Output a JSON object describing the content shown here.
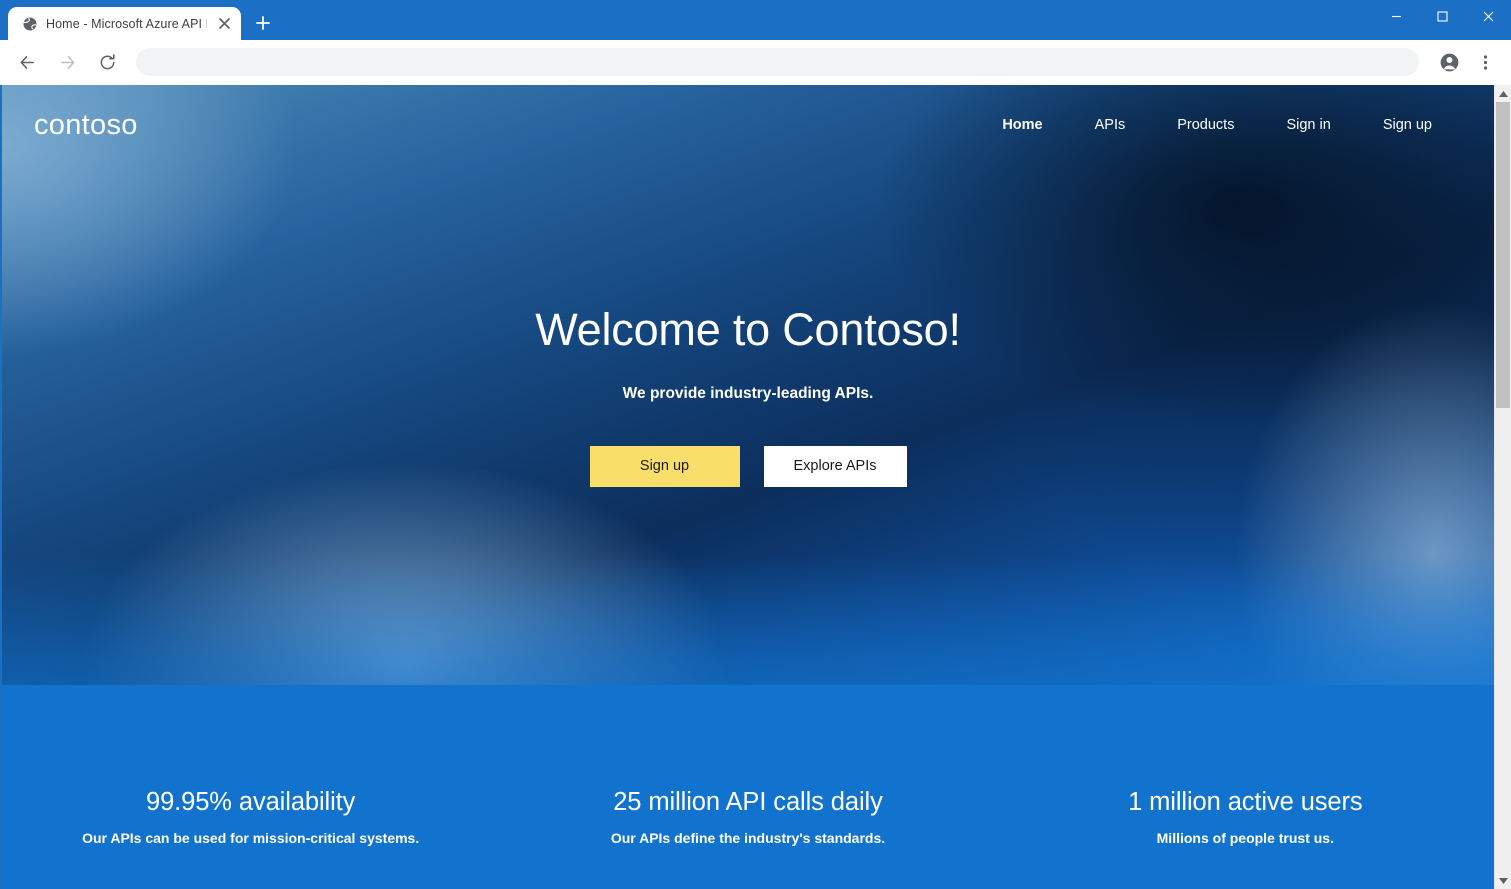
{
  "browser": {
    "tab": {
      "title": "Home - Microsoft Azure API Man",
      "favicon_icon": "globe-icon",
      "close_icon": "close-icon"
    },
    "new_tab_icon": "plus-icon",
    "window_controls": {
      "minimize_icon": "minimize-icon",
      "maximize_icon": "maximize-icon",
      "close_icon": "close-icon"
    },
    "toolbar": {
      "back_icon": "back-arrow-icon",
      "forward_icon": "forward-arrow-icon",
      "reload_icon": "reload-icon",
      "address_value": "",
      "address_placeholder": "",
      "profile_icon": "account-circle-icon",
      "menu_icon": "three-dot-menu-icon"
    },
    "scrollbar": {
      "up_icon": "scroll-up-arrow-icon",
      "down_icon": "scroll-down-arrow-icon"
    }
  },
  "site": {
    "brand": "contoso",
    "nav": [
      {
        "label": "Home",
        "active": true
      },
      {
        "label": "APIs",
        "active": false
      },
      {
        "label": "Products",
        "active": false
      },
      {
        "label": "Sign in",
        "active": false
      },
      {
        "label": "Sign up",
        "active": false
      }
    ],
    "hero": {
      "title": "Welcome to Contoso!",
      "subtitle": "We provide industry-leading APIs.",
      "primary_button": "Sign up",
      "secondary_button": "Explore APIs"
    },
    "stats": [
      {
        "value": "99.95% availability",
        "desc": "Our APIs can be used for mission-critical systems."
      },
      {
        "value": "25 million API calls daily",
        "desc": "Our APIs define the industry's standards."
      },
      {
        "value": "1 million active users",
        "desc": "Millions of people trust us."
      }
    ]
  },
  "colors": {
    "brand_blue": "#1273CE",
    "chrome_blue": "#1B6FC5",
    "accent_yellow": "#FADE6A",
    "hero_dark_navy": "#0A2647",
    "hero_light_blue": "#4E8CB8"
  }
}
